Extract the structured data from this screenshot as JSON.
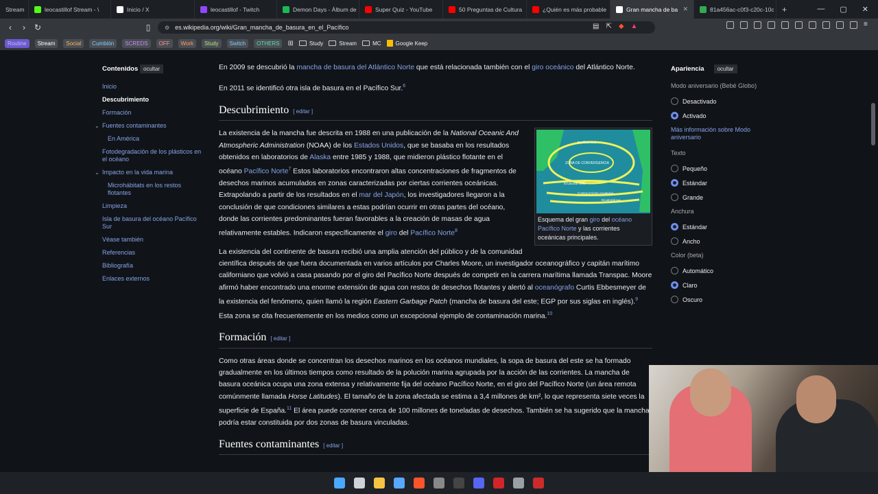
{
  "tabs": [
    {
      "label": "Stream",
      "color": "#3a3d42"
    },
    {
      "label": "leocastillof Stream - \\",
      "color": "#53fc18"
    },
    {
      "label": "Inicio / X",
      "color": "#ffffff"
    },
    {
      "label": "leocastillof - Twitch",
      "color": "#9146ff"
    },
    {
      "label": "Demon Days - Álbum de",
      "color": "#1db954"
    },
    {
      "label": "Super Quiz - YouTube",
      "color": "#ff0000"
    },
    {
      "label": "50 Preguntas de Cultura",
      "color": "#ff0000"
    },
    {
      "label": "¿Quién es más probable",
      "color": "#ff0000"
    },
    {
      "label": "Gran mancha de ba",
      "color": "#ffffff",
      "active": true
    },
    {
      "label": "81a456ac-c0f3-c20c-10c",
      "color": "#34a853"
    }
  ],
  "address": {
    "url": "es.wikipedia.org/wiki/Gran_mancha_de_basura_en_el_Pacífico"
  },
  "bookmarks": [
    "Routine",
    "Stream",
    "Social",
    "Cumbión",
    "SCREDS",
    "OFF",
    "Work",
    "Study",
    "Switch",
    "OTHERS"
  ],
  "bookmark_colors": [
    "#6a5acd",
    "#4a4e54",
    "#4a4e54",
    "#4a4e54",
    "#4a4e54",
    "#4a4e54",
    "#4a4e54",
    "#4a4e54",
    "#4a4e54",
    "#4a4e54"
  ],
  "bookmark_text_colors": [
    "#c9b8ff",
    "#ffffff",
    "#ffb454",
    "#7fd0ff",
    "#c78bff",
    "#ff8f8f",
    "#ff9f5f",
    "#b0e57c",
    "#7fd0ff",
    "#5fe0a8"
  ],
  "bookmark_folders": [
    "Study",
    "Stream",
    "MC"
  ],
  "bookmark_keep": "Google Keep",
  "toc": {
    "title": "Contenidos",
    "hide": "ocultar",
    "items": [
      {
        "label": "Inicio"
      },
      {
        "label": "Descubrimiento",
        "current": true
      },
      {
        "label": "Formación"
      },
      {
        "label": "Fuentes contaminantes",
        "chevron": true
      },
      {
        "label": "En América",
        "sub": true
      },
      {
        "label": "Fotodegradación de los plásticos en el océano"
      },
      {
        "label": "Impacto en la vida marina",
        "chevron": true
      },
      {
        "label": "Microhábitats en los restos flotantes",
        "sub": true
      },
      {
        "label": "Limpieza"
      },
      {
        "label": "Isla de basura del océano Pacífico Sur"
      },
      {
        "label": "Véase también"
      },
      {
        "label": "Referencias"
      },
      {
        "label": "Bibliografía"
      },
      {
        "label": "Enlaces externos"
      }
    ]
  },
  "article": {
    "intro1_a": "En 2009 se descubrió la ",
    "intro1_link1": "mancha de basura del Atlántico Norte",
    "intro1_b": " que está relacionada también con el ",
    "intro1_link2": "giro oceánico",
    "intro1_c": " del Atlántico Norte.",
    "intro2": "En 2011 se identificó otra isla de basura en el Pacífico Sur.",
    "intro2_ref": "6",
    "h_descubrimiento": "Descubrimiento",
    "edit": "editar",
    "d1_a": "La existencia de la mancha fue descrita en 1988 en una publicación de la ",
    "d1_em": "National Oceanic And Atmospheric Administration",
    "d1_b": " (NOAA) de los ",
    "d1_link1": "Estados Unidos",
    "d1_c": ", que se basaba en los resultados obtenidos en laboratorios de ",
    "d1_link2": "Alaska",
    "d1_d": " entre 1985 y 1988, que midieron plástico flotante en el océano ",
    "d1_link3": "Pacífico Norte",
    "d1_ref1": "7",
    "d1_e": " Estos laboratorios encontraron altas concentraciones de fragmentos de desechos marinos acumulados en zonas caracterizadas por ciertas corrientes oceánicas. Extrapolando a partir de los resultados en el ",
    "d1_link4": "mar del Japón",
    "d1_f": ", los investigadores llegaron a la conclusión de que condiciones similares a estas podrían ocurrir en otras partes del océano, donde las corrientes predominantes fueran favorables a la creación de masas de agua relativamente estables. Indicaron específicamente el ",
    "d1_link5": "giro",
    "d1_g": " del ",
    "d1_link6": "Pacífico Norte",
    "d1_ref2": "8",
    "d2_a": "La existencia del continente de basura recibió una amplia atención del público y de la comunidad científica después de que fuera documentada en varios artículos por Charles Moore, un investigador oceanográfico y capitán marítimo californiano que volvió a casa pasando por el giro del Pacífico Norte después de competir en la carrera marítima llamada Transpac. Moore afirmó haber encontrado una enorme extensión de agua con restos de desechos flotantes y alertó al ",
    "d2_link": "oceanógrafo",
    "d2_b": " Curtis Ebbesmeyer de la existencia del fenómeno, quien llamó la región ",
    "d2_em": "Eastern Garbage Patch",
    "d2_c": " (mancha de basura del este; EGP por sus siglas en inglés).",
    "d2_ref1": "9",
    "d2_d": " Esta zona se cita frecuentemente en los medios como un excepcional ejemplo de contaminación marina.",
    "d2_ref2": "10",
    "h_formacion": "Formación",
    "f1_a": "Como otras áreas donde se concentran los desechos marinos en los océanos mundiales, la sopa de basura del este se ha formado gradualmente en los últimos tiempos como resultado de la polución marina agrupada por la acción de las corrientes. La mancha de basura oceánica ocupa una zona extensa y relativamente fija del océano Pacífico Norte, en el giro del Pacífico Norte (un área remota comúnmente llamada ",
    "f1_em": "Horse Latitudes",
    "f1_b": "). El tamaño de la zona afectada se estima a 3,4 millones de km², lo que representa siete veces la superficie de España.",
    "f1_ref": "11",
    "f1_c": " El área puede contener cerca de 100 millones de toneladas de desechos. También se ha sugerido que la mancha podría estar constituida por dos zonas de basura vinculadas.",
    "h_fuentes": "Fuentes contaminantes"
  },
  "figure": {
    "cap_a": "Esquema del gran ",
    "cap_link1": "giro",
    "cap_b": " del ",
    "cap_link2": "océano Pacífico Norte",
    "cap_c": " y las corrientes oceánicas principales.",
    "map_labels": [
      "Pacífico norte",
      "ZONA DE CONVERGENCIA",
      "Ecuatorial norte",
      "Contracorriente ecuatorial",
      "Ecuatorial sur"
    ]
  },
  "appearance": {
    "title": "Apariencia",
    "hide": "ocultar",
    "mode_label": "Modo aniversario (Bebé Globo)",
    "mode_options": [
      {
        "label": "Desactivado",
        "on": false
      },
      {
        "label": "Activado",
        "on": true
      }
    ],
    "mode_link": "Más información sobre Modo aniversario",
    "text_label": "Texto",
    "text_options": [
      {
        "label": "Pequeño",
        "on": false
      },
      {
        "label": "Estándar",
        "on": true
      },
      {
        "label": "Grande",
        "on": false
      }
    ],
    "width_label": "Anchura",
    "width_options": [
      {
        "label": "Estándar",
        "on": true
      },
      {
        "label": "Ancho",
        "on": false
      }
    ],
    "color_label": "Color (beta)",
    "color_options": [
      {
        "label": "Automático",
        "on": false
      },
      {
        "label": "Claro",
        "on": true
      },
      {
        "label": "Oscuro",
        "on": false
      }
    ]
  },
  "taskbar_icons": [
    {
      "name": "windows-start-icon",
      "color": "#4aa8ff"
    },
    {
      "name": "task-view-icon",
      "color": "#cfd3d8"
    },
    {
      "name": "file-explorer-icon",
      "color": "#f4c542"
    },
    {
      "name": "store-icon",
      "color": "#58a6ff"
    },
    {
      "name": "brave-icon",
      "color": "#fb542b"
    },
    {
      "name": "app-icon",
      "color": "#888888"
    },
    {
      "name": "obs-icon",
      "color": "#444444"
    },
    {
      "name": "discord-icon",
      "color": "#5865f2"
    },
    {
      "name": "app-red-icon",
      "color": "#d3242b"
    },
    {
      "name": "settings-icon",
      "color": "#9aa0a6"
    },
    {
      "name": "app-red2-icon",
      "color": "#cc2b2b"
    }
  ]
}
